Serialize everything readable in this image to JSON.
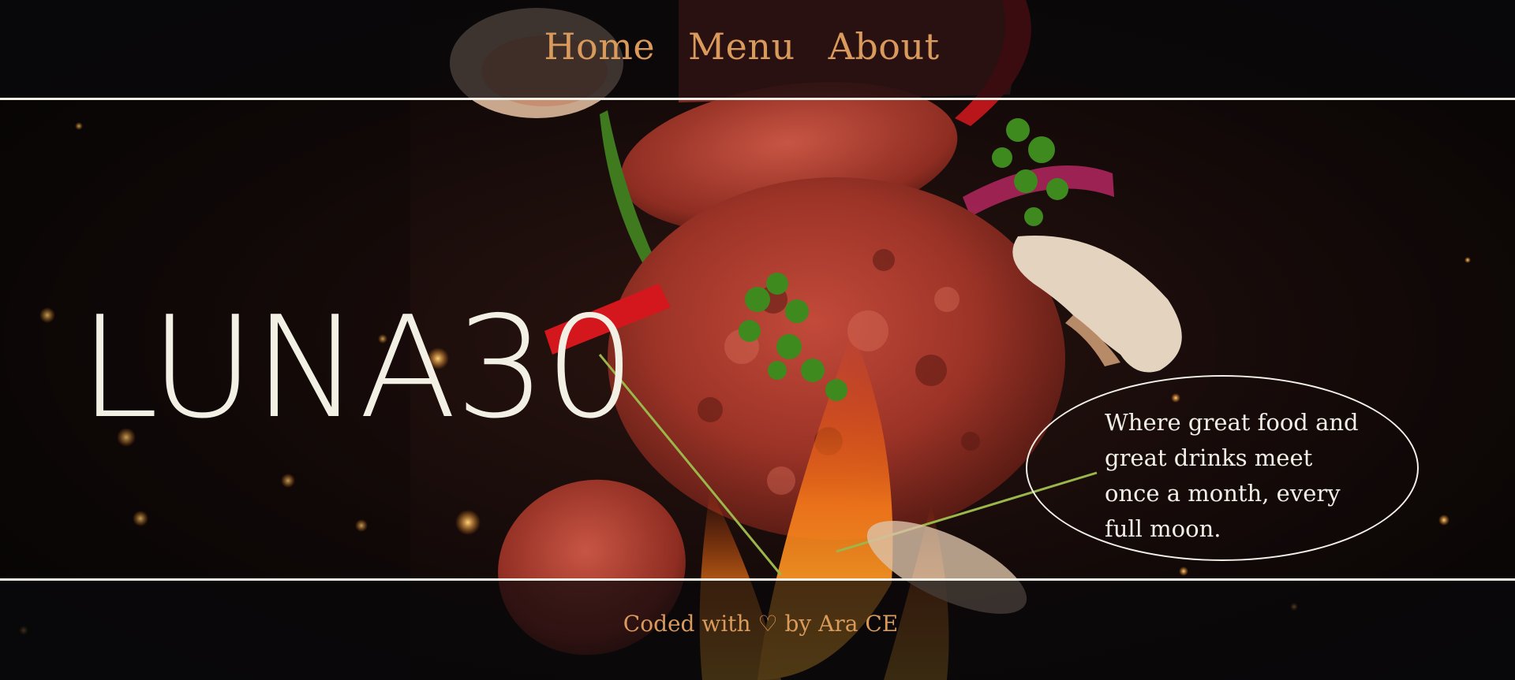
{
  "nav": {
    "items": [
      "Home",
      "Menu",
      "About"
    ]
  },
  "hero": {
    "brand": "LUNA30",
    "tagline": "Where great food and great drinks meet once a month, every full moon."
  },
  "footer": {
    "credit": "Coded with ♡ by Ara CE"
  },
  "colors": {
    "accent": "#d99a5b",
    "text_light": "#f2efe6",
    "background": "#0a0808"
  },
  "background_image": "flying-burger-patty-with-herbs-and-flames"
}
